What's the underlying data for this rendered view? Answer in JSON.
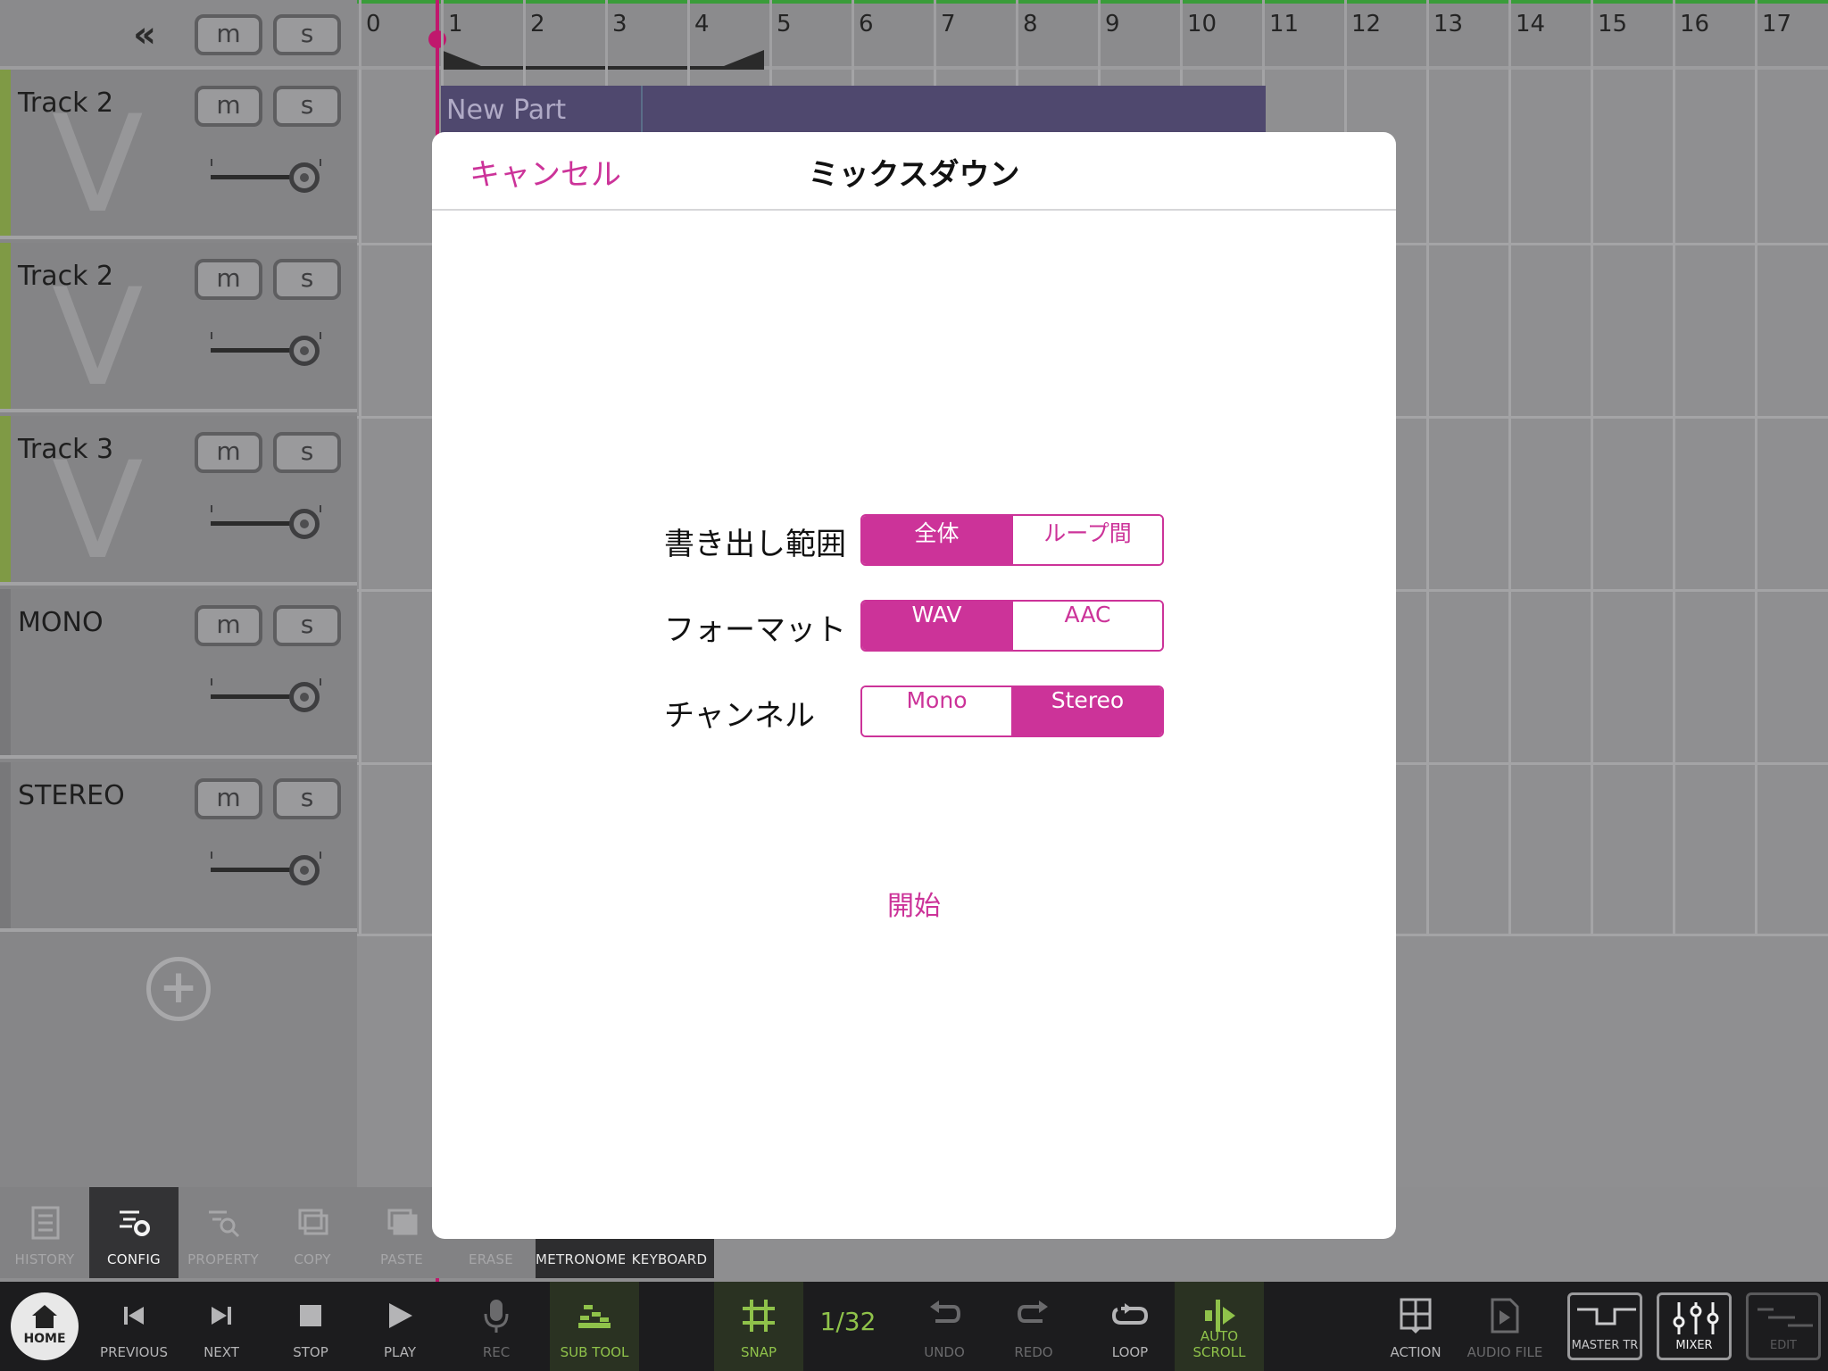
{
  "header": {
    "collapse_glyph": "«",
    "mute_label": "m",
    "solo_label": "s"
  },
  "tracks": [
    {
      "name": "Track 2",
      "mute": "m",
      "solo": "s",
      "color": "#7f9a45",
      "volume": 0.7
    },
    {
      "name": "Track 2",
      "mute": "m",
      "solo": "s",
      "color": "#7f9a45",
      "volume": 0.7
    },
    {
      "name": "Track 3",
      "mute": "m",
      "solo": "s",
      "color": "#7f9a45",
      "volume": 0.7
    },
    {
      "name": "MONO",
      "mute": "m",
      "solo": "s",
      "color": "#78787a",
      "volume": 0.7
    },
    {
      "name": "STEREO",
      "mute": "m",
      "solo": "s",
      "color": "#78787a",
      "volume": 0.7
    }
  ],
  "add_track_glyph": "+",
  "timeline": {
    "ruler_numbers": [
      "0",
      "1",
      "2",
      "3",
      "4",
      "5",
      "6",
      "7",
      "8",
      "9",
      "10",
      "11",
      "12",
      "13",
      "14",
      "15",
      "16",
      "17"
    ],
    "part_label": "New Part",
    "playhead_color": "#c0186d"
  },
  "tools": [
    {
      "label": "HISTORY",
      "icon": "history-icon"
    },
    {
      "label": "CONFIG",
      "icon": "config-icon"
    },
    {
      "label": "PROPERTY",
      "icon": "property-icon"
    },
    {
      "label": "COPY",
      "icon": "copy-icon"
    },
    {
      "label": "PASTE",
      "icon": "paste-icon"
    },
    {
      "label": "ERASE",
      "icon": "erase-icon"
    },
    {
      "label": "METRONOME",
      "icon": "metronome-icon"
    },
    {
      "label": "KEYBOARD",
      "icon": "keyboard-icon"
    }
  ],
  "transport": {
    "home": "HOME",
    "previous": "PREVIOUS",
    "next": "NEXT",
    "stop": "STOP",
    "play": "PLAY",
    "rec": "REC",
    "sub_tool": "SUB TOOL",
    "snap": "SNAP",
    "snap_value": "1/32",
    "undo": "UNDO",
    "redo": "REDO",
    "loop": "LOOP",
    "auto_scroll": "AUTO SCROLL",
    "action": "ACTION",
    "audio_file": "AUDIO FILE",
    "master_tr": "MASTER TR",
    "mixer": "MIXER",
    "edit": "EDIT"
  },
  "modal": {
    "cancel": "キャンセル",
    "title": "ミックスダウン",
    "rows": [
      {
        "label": "書き出し範囲",
        "options": [
          "全体",
          "ループ間"
        ],
        "selected": 0
      },
      {
        "label": "フォーマット",
        "options": [
          "WAV",
          "AAC"
        ],
        "selected": 0
      },
      {
        "label": "チャンネル",
        "options": [
          "Mono",
          "Stereo"
        ],
        "selected": 1
      }
    ],
    "start": "開始",
    "accent": "#cc3399"
  }
}
